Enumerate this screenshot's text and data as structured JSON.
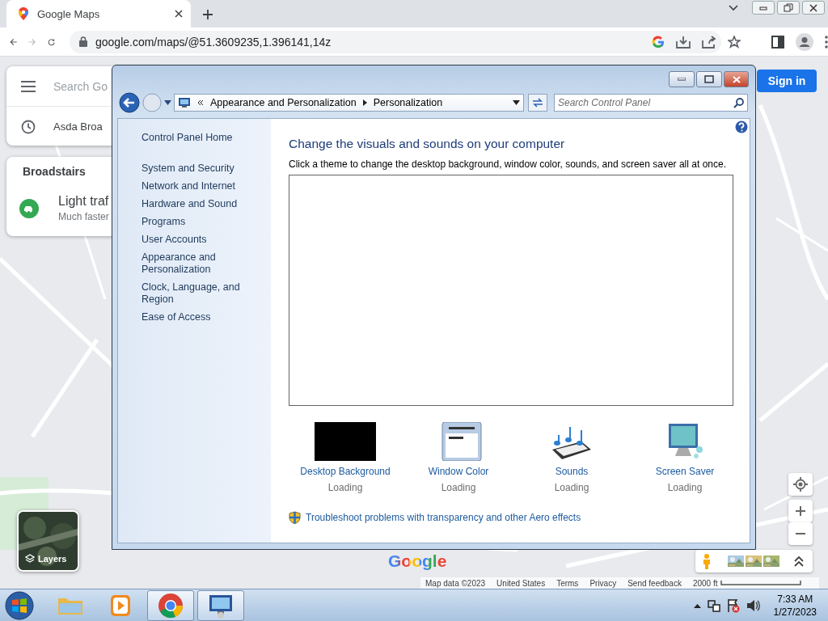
{
  "browser": {
    "tabs": [
      {
        "title": "Google Maps",
        "selected": true
      }
    ],
    "forward_disabled": true,
    "url": "google.com/maps/@51.3609235,1.396141,14z"
  },
  "maps": {
    "search_placeholder": "Search Go",
    "recent": "Asda Broa",
    "card_title": "Broadstairs",
    "traffic_title": "Light traf",
    "traffic_sub": "Much faster",
    "sign_in": "Sign in",
    "layers": "Layers",
    "logo": "Google",
    "footer": [
      "Map data ©2023",
      "United States",
      "Terms",
      "Privacy",
      "Send feedback"
    ],
    "scale": "2000 ft"
  },
  "window": {
    "breadcrumb": [
      "Appearance and Personalization",
      "Personalization"
    ],
    "search_placeholder": "Search Control Panel",
    "home": "Control Panel Home",
    "sidebar": [
      "System and Security",
      "Network and Internet",
      "Hardware and Sound",
      "Programs",
      "User Accounts",
      "Appearance and Personalization",
      "Clock, Language, and Region",
      "Ease of Access"
    ],
    "heading": "Change the visuals and sounds on your computer",
    "description": "Click a theme to change the desktop background, window color, sounds, and screen saver all at once.",
    "items": [
      {
        "kind": "background",
        "label": "Desktop Background",
        "status": "Loading"
      },
      {
        "kind": "color",
        "label": "Window Color",
        "status": "Loading"
      },
      {
        "kind": "sounds",
        "label": "Sounds",
        "status": "Loading"
      },
      {
        "kind": "screensaver",
        "label": "Screen Saver",
        "status": "Loading"
      }
    ],
    "troubleshoot": "Troubleshoot problems with transparency and other Aero effects"
  },
  "taskbar": {
    "apps": [
      {
        "kind": "explorer",
        "active": false
      },
      {
        "kind": "media",
        "active": false
      },
      {
        "kind": "chrome",
        "active": true
      },
      {
        "kind": "control-panel",
        "active": true
      }
    ],
    "time": "7:33 AM",
    "date": "1/27/2023"
  }
}
